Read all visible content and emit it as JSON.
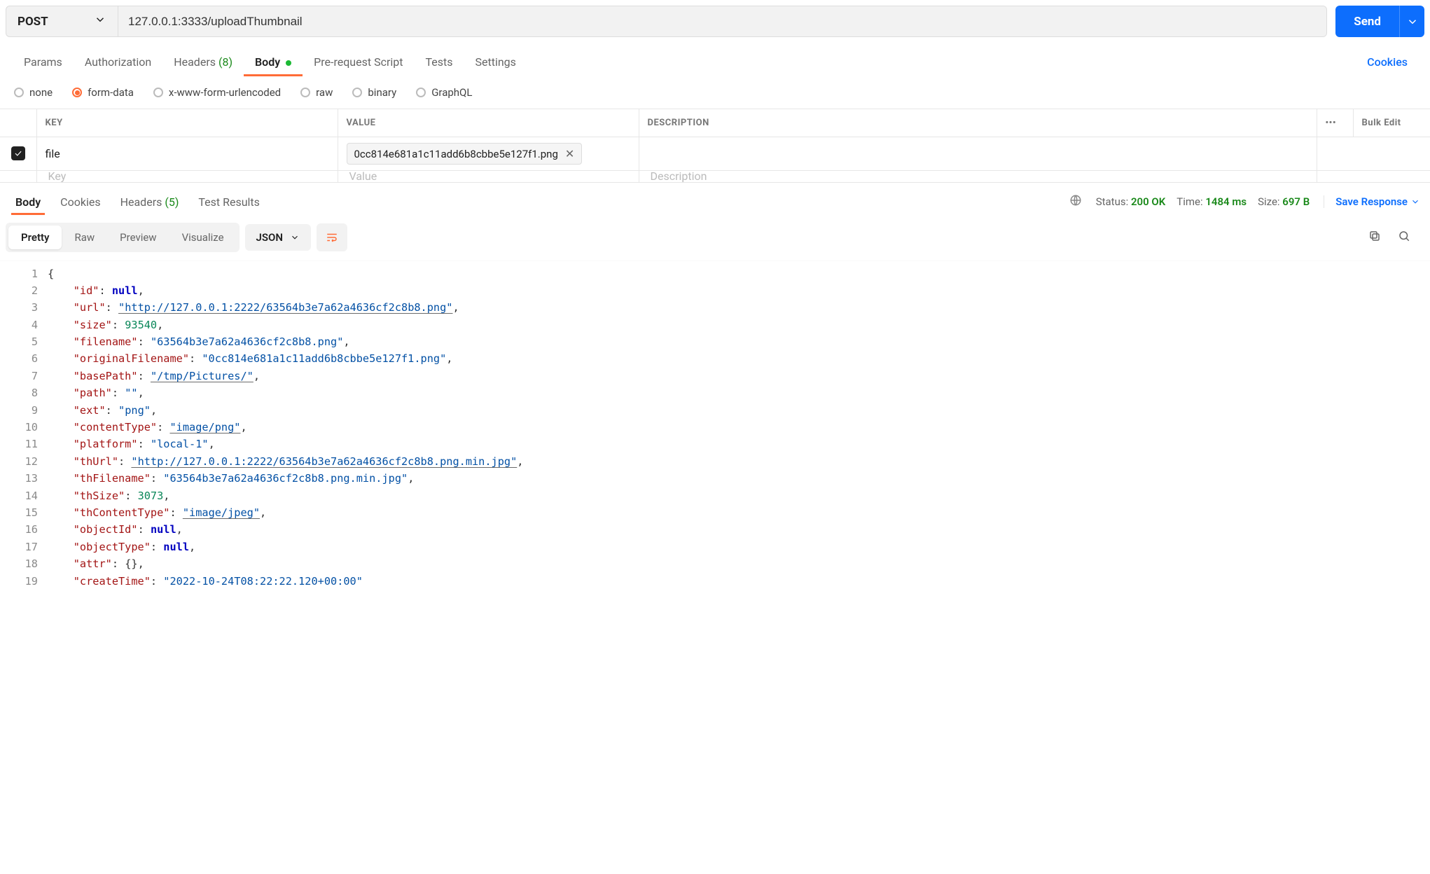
{
  "request": {
    "method": "POST",
    "url": "127.0.0.1:3333/uploadThumbnail",
    "send_label": "Send"
  },
  "request_tabs": {
    "params": "Params",
    "authorization": "Authorization",
    "headers": "Headers",
    "headers_count": "(8)",
    "body": "Body",
    "prerequest": "Pre-request Script",
    "tests": "Tests",
    "settings": "Settings",
    "cookies": "Cookies"
  },
  "body_types": {
    "none": "none",
    "formdata": "form-data",
    "urlencoded": "x-www-form-urlencoded",
    "raw": "raw",
    "binary": "binary",
    "graphql": "GraphQL"
  },
  "formdata": {
    "headers": {
      "key": "KEY",
      "value": "VALUE",
      "description": "DESCRIPTION",
      "options": "•••",
      "bulk": "Bulk Edit"
    },
    "rows": [
      {
        "checked": true,
        "key": "file",
        "file_chip": "0cc814e681a1c11add6b8cbbe5e127f1.png"
      }
    ],
    "placeholder": {
      "key": "Key",
      "value": "Value",
      "description": "Description"
    }
  },
  "response_tabs": {
    "body": "Body",
    "cookies": "Cookies",
    "headers": "Headers",
    "headers_count": "(5)",
    "test_results": "Test Results"
  },
  "response_meta": {
    "status_label": "Status:",
    "status_value": "200 OK",
    "time_label": "Time:",
    "time_value": "1484 ms",
    "size_label": "Size:",
    "size_value": "697 B",
    "save": "Save Response"
  },
  "response_toolbar": {
    "pretty": "Pretty",
    "raw": "Raw",
    "preview": "Preview",
    "visualize": "Visualize",
    "format": "JSON"
  },
  "json_lines": [
    {
      "n": 1,
      "type": "brace",
      "text": "{"
    },
    {
      "n": 2,
      "type": "kv",
      "key": "\"id\"",
      "val": "null",
      "valType": "null",
      "comma": true
    },
    {
      "n": 3,
      "type": "kv",
      "key": "\"url\"",
      "val": "\"http://127.0.0.1:2222/63564b3e7a62a4636cf2c8b8.png\"",
      "valType": "str",
      "link": true,
      "comma": true
    },
    {
      "n": 4,
      "type": "kv",
      "key": "\"size\"",
      "val": "93540",
      "valType": "num",
      "comma": true
    },
    {
      "n": 5,
      "type": "kv",
      "key": "\"filename\"",
      "val": "\"63564b3e7a62a4636cf2c8b8.png\"",
      "valType": "str",
      "comma": true
    },
    {
      "n": 6,
      "type": "kv",
      "key": "\"originalFilename\"",
      "val": "\"0cc814e681a1c11add6b8cbbe5e127f1.png\"",
      "valType": "str",
      "comma": true
    },
    {
      "n": 7,
      "type": "kv",
      "key": "\"basePath\"",
      "val": "\"/tmp/Pictures/\"",
      "valType": "str",
      "link": true,
      "comma": true
    },
    {
      "n": 8,
      "type": "kv",
      "key": "\"path\"",
      "val": "\"\"",
      "valType": "str",
      "comma": true
    },
    {
      "n": 9,
      "type": "kv",
      "key": "\"ext\"",
      "val": "\"png\"",
      "valType": "str",
      "comma": true
    },
    {
      "n": 10,
      "type": "kv",
      "key": "\"contentType\"",
      "val": "\"image/png\"",
      "valType": "str",
      "link": true,
      "comma": true
    },
    {
      "n": 11,
      "type": "kv",
      "key": "\"platform\"",
      "val": "\"local-1\"",
      "valType": "str",
      "comma": true
    },
    {
      "n": 12,
      "type": "kv",
      "key": "\"thUrl\"",
      "val": "\"http://127.0.0.1:2222/63564b3e7a62a4636cf2c8b8.png.min.jpg\"",
      "valType": "str",
      "link": true,
      "comma": true
    },
    {
      "n": 13,
      "type": "kv",
      "key": "\"thFilename\"",
      "val": "\"63564b3e7a62a4636cf2c8b8.png.min.jpg\"",
      "valType": "str",
      "comma": true
    },
    {
      "n": 14,
      "type": "kv",
      "key": "\"thSize\"",
      "val": "3073",
      "valType": "num",
      "comma": true
    },
    {
      "n": 15,
      "type": "kv",
      "key": "\"thContentType\"",
      "val": "\"image/jpeg\"",
      "valType": "str",
      "link": true,
      "comma": true
    },
    {
      "n": 16,
      "type": "kv",
      "key": "\"objectId\"",
      "val": "null",
      "valType": "null",
      "comma": true
    },
    {
      "n": 17,
      "type": "kv",
      "key": "\"objectType\"",
      "val": "null",
      "valType": "null",
      "comma": true
    },
    {
      "n": 18,
      "type": "kv",
      "key": "\"attr\"",
      "val": "{}",
      "valType": "brace",
      "comma": true
    },
    {
      "n": 19,
      "type": "kv",
      "key": "\"createTime\"",
      "val": "\"2022-10-24T08:22:22.120+00:00\"",
      "valType": "str",
      "comma": false,
      "cutoff": true
    }
  ]
}
